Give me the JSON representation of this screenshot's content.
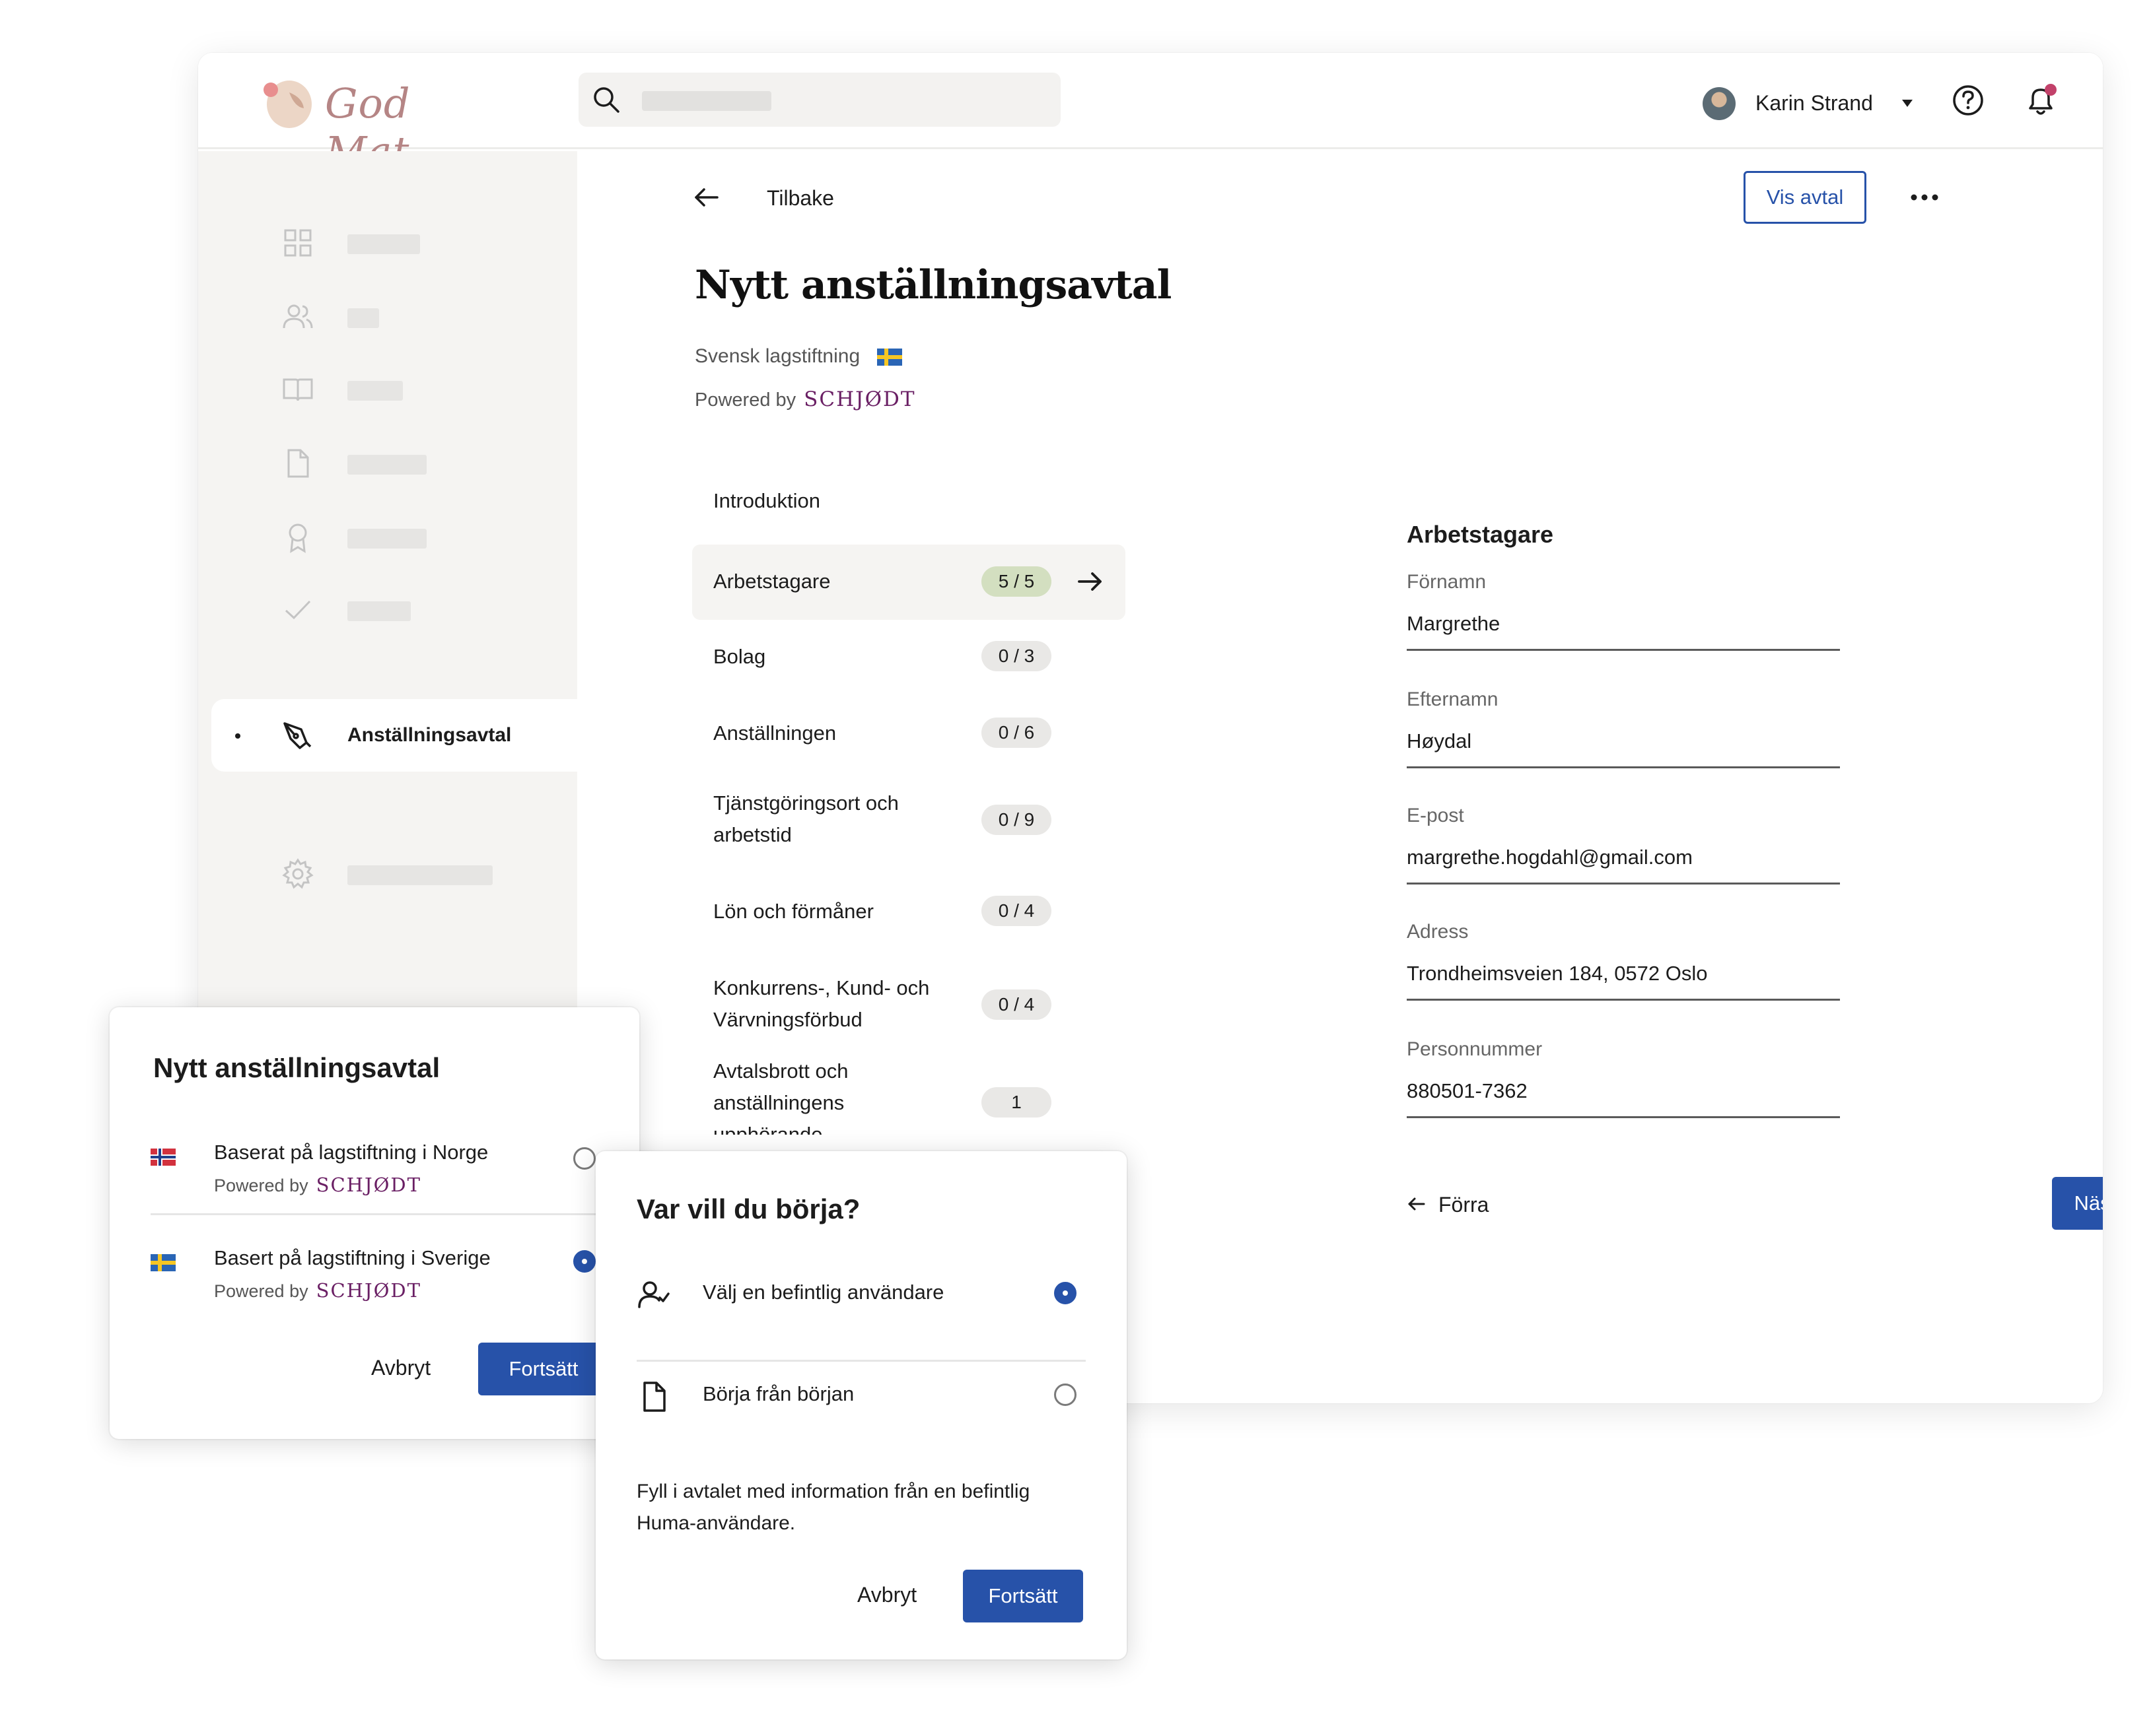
{
  "app": {
    "brand_name": "God Mat",
    "brand_color": "#b58585",
    "accent": "#2752a9"
  },
  "header": {
    "search_placeholder": "",
    "user_name": "Karin Strand",
    "icons": [
      "search-icon",
      "chevron-down-icon",
      "help-icon",
      "bell-icon"
    ],
    "notification_dot_color": "#c2416a"
  },
  "sidebar": {
    "items": [
      {
        "icon": "grid-icon"
      },
      {
        "icon": "users-icon"
      },
      {
        "icon": "book-icon"
      },
      {
        "icon": "document-icon"
      },
      {
        "icon": "award-icon"
      },
      {
        "icon": "check-icon"
      },
      {
        "icon": "pen-tool-icon",
        "label": "Anställningsavtal",
        "active": true
      },
      {
        "icon": "settings-icon"
      }
    ]
  },
  "page": {
    "back_label": "Tilbake",
    "show_contract_label": "Vis avtal",
    "title": "Nytt anställningsavtal",
    "law": "Svensk lagstiftning",
    "powered_by": "Powered by",
    "powered_brand": "SCHJØDT"
  },
  "steps": [
    {
      "label": "Introduktion",
      "badge": ""
    },
    {
      "label": "Arbetstagare",
      "badge": "5 / 5",
      "active": true
    },
    {
      "label": "Bolag",
      "badge": "0 / 3"
    },
    {
      "label": "Anställningen",
      "badge": "0 / 6"
    },
    {
      "label_line1": "Tjänstgöringsort och",
      "label_line2": "arbetstid",
      "badge": "0 / 9"
    },
    {
      "label": "Lön och förmåner",
      "badge": "0 / 4"
    },
    {
      "label_line1": "Konkurrens-, Kund- och",
      "label_line2": "Värvningsförbud",
      "badge": "0 / 4"
    },
    {
      "label_line1": "Avtalsbrott och",
      "label_line2": "anställningens",
      "label_line3": "upphörande",
      "badge": "1"
    }
  ],
  "form": {
    "title": "Arbetstagare",
    "fields": [
      {
        "label": "Förnamn",
        "value": "Margrethe"
      },
      {
        "label": "Efternamn",
        "value": "Høydal"
      },
      {
        "label": "E-post",
        "value": "margrethe.hogdahl@gmail.com"
      },
      {
        "label": "Adress",
        "value": "Trondheimsveien 184, 0572 Oslo"
      },
      {
        "label": "Personnummer",
        "value": "880501-7362"
      }
    ],
    "prev_label": "Förra",
    "next_label": "Nästa"
  },
  "modal_country": {
    "title": "Nytt anställningsavtal",
    "options": [
      {
        "title": "Baserat på lagstiftning i Norge",
        "powered_by": "Powered by",
        "brand": "SCHJØDT",
        "flag": "norway-flag-icon",
        "selected": false
      },
      {
        "title": "Basert på lagstiftning i Sverige",
        "powered_by": "Powered by",
        "brand": "SCHJØDT",
        "flag": "sweden-flag-icon",
        "selected": true
      }
    ],
    "cancel_label": "Avbryt",
    "continue_label": "Fortsätt"
  },
  "modal_start": {
    "title": "Var vill du börja?",
    "options": [
      {
        "label": "Välj en befintlig användare",
        "icon": "user-check-icon",
        "selected": true
      },
      {
        "label": "Börja från början",
        "icon": "document-icon",
        "selected": false
      }
    ],
    "description": "Fyll i avtalet med information från en befintlig Huma-användare.",
    "cancel_label": "Avbryt",
    "continue_label": "Fortsätt"
  }
}
